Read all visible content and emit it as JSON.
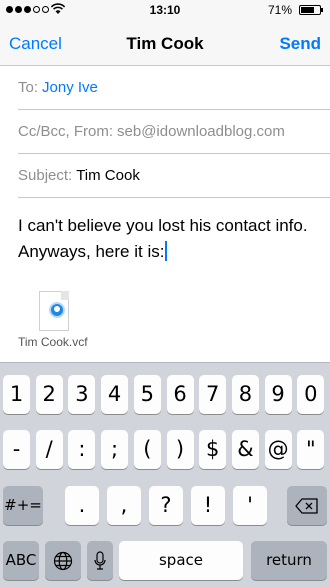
{
  "status_bar": {
    "time": "13:10",
    "battery_percent": "71%",
    "signal_bars": 3,
    "signal_total": 5,
    "battery_level": 0.71
  },
  "nav": {
    "cancel_label": "Cancel",
    "title": "Tim Cook",
    "send_label": "Send"
  },
  "compose": {
    "to_label": "To:",
    "to_value": "Jony Ive",
    "ccbcc_label": "Cc/Bcc, From:",
    "from_value": "seb@idownloadblog.com",
    "subject_label": "Subject:",
    "subject_value": "Tim Cook",
    "body": "I can't believe you lost his contact info. Anyways, here it is:",
    "attachment_name": "Tim Cook.vcf"
  },
  "keyboard": {
    "row1": [
      "1",
      "2",
      "3",
      "4",
      "5",
      "6",
      "7",
      "8",
      "9",
      "0"
    ],
    "row2": [
      "-",
      "/",
      ":",
      ";",
      "(",
      ")",
      "$",
      "&",
      "@",
      "\""
    ],
    "row3_left": "#+=",
    "row3": [
      ".",
      ",",
      "?",
      "!",
      "'"
    ],
    "abc": "ABC",
    "space": "space",
    "return": "return"
  },
  "colors": {
    "accent": "#007aff",
    "placeholder": "#8e8e93",
    "keyboard_bg": "#d1d5db"
  }
}
